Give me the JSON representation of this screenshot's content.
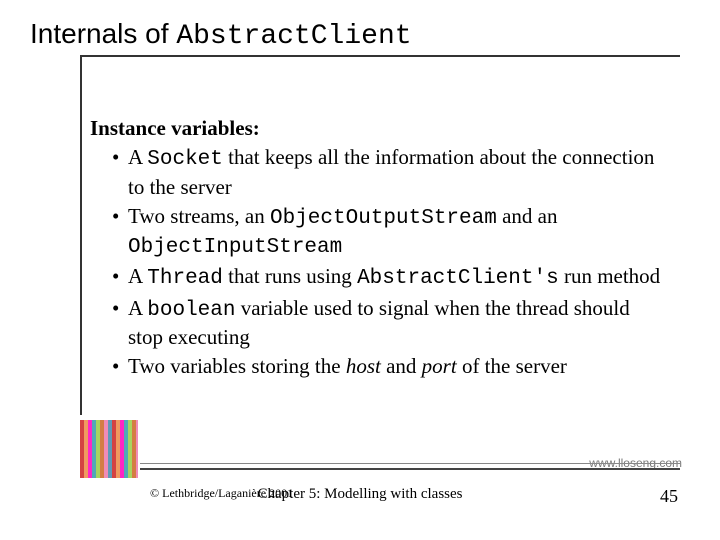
{
  "title": {
    "prefix": "Internals of ",
    "mono": "AbstractClient"
  },
  "heading": "Instance variables:",
  "bullets": {
    "b1a": "A ",
    "b1mono": "Socket",
    "b1b": " that keeps all the information about the connection to the server",
    "b2a": "Two streams, an ",
    "b2m1": "ObjectOutputStream",
    "b2b": " and an ",
    "b2m2": "ObjectInputStream",
    "b3a": "A ",
    "b3m1": "Thread",
    "b3b": " that runs using ",
    "b3m2": "AbstractClient's",
    "b3c": " run method",
    "b4a": "A ",
    "b4m": "boolean",
    "b4b": " variable used to signal when the thread should stop executing",
    "b5a": "Two variables storing the ",
    "b5e1": "host",
    "b5b": " and ",
    "b5e2": "port",
    "b5c": " of the server"
  },
  "weblink": "www.lloseng.com",
  "copyright": "© Lethbridge/Laganière 2001",
  "chapter": "Chapter 5: Modelling with classes",
  "pagenum": "45"
}
